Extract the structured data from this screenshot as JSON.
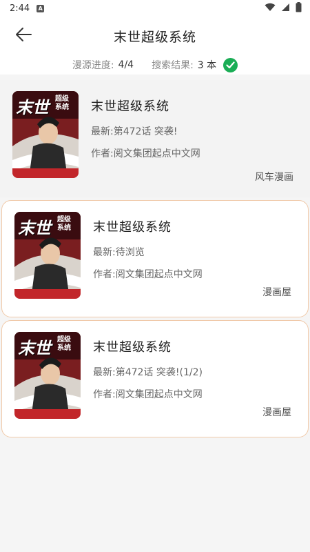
{
  "status_bar": {
    "time": "2:44",
    "sim_label": "A"
  },
  "header": {
    "title": "末世超级系统"
  },
  "progress": {
    "source_label": "漫源进度:",
    "source_value": "4/4",
    "result_label": "搜索结果:",
    "result_value": "3 本"
  },
  "cover_text": {
    "line1": "末世",
    "line2": "超级",
    "line3": "系统"
  },
  "results": [
    {
      "title": "末世超级系统",
      "latest": "最新:第472话 突袭!",
      "author": "作者:阅文集团起点中文网",
      "source": "风车漫画"
    },
    {
      "title": "末世超级系统",
      "latest": "最新:待浏览",
      "author": "作者:阅文集团起点中文网",
      "source": "漫画屋"
    },
    {
      "title": "末世超级系统",
      "latest": "最新:第472话 突袭!(1/2)",
      "author": "作者:阅文集团起点中文网",
      "source": "漫画屋"
    }
  ],
  "colors": {
    "accent_check": "#1aad55",
    "card_border": "#f0c9a8"
  }
}
